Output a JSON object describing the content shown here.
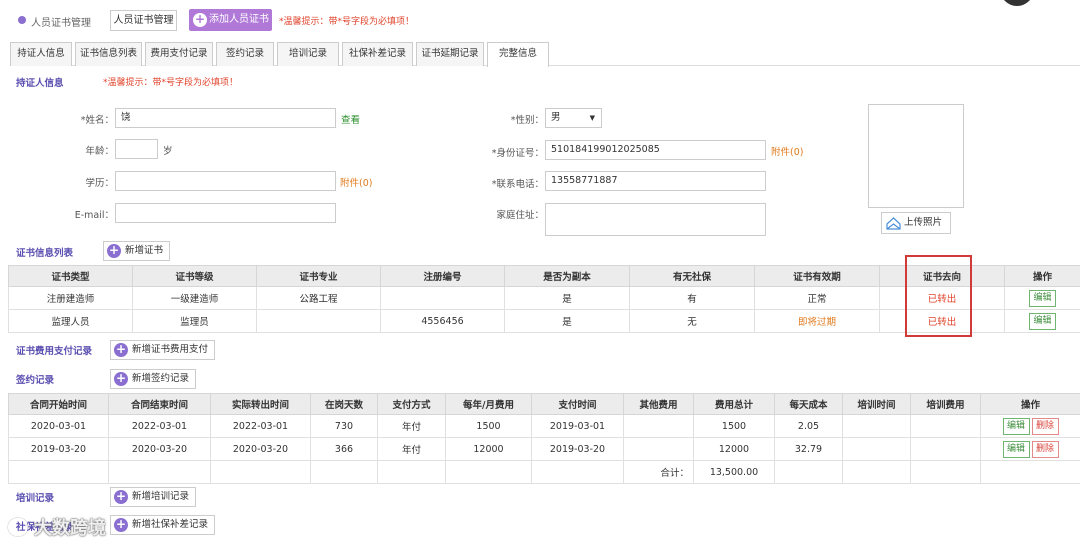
{
  "topbar": {
    "breadcrumb": "人员证书管理",
    "tab_button": "人员证书管理",
    "add_button": "添加人员证书",
    "warning": "*温馨提示：带*号字段为必填项！"
  },
  "tabs": [
    "持证人信息",
    "证书信息列表",
    "费用支付记录",
    "签约记录",
    "培训记录",
    "社保补差记录",
    "证书延期记录",
    "完整信息"
  ],
  "holder": {
    "title": "持证人信息",
    "warning": "*温馨提示：带*号字段为必填项！",
    "name_label": "*姓名：",
    "name_value": "饶",
    "view_link": "查看",
    "gender_label": "*性别：",
    "gender_value": "男",
    "age_label": "年龄：",
    "age_unit": "岁",
    "id_label": "*身份证号：",
    "id_value": "510184199012025085",
    "id_attach": "附件(0)",
    "edu_label": "学历：",
    "edu_attach": "附件(0)",
    "phone_label": "*联系电话：",
    "phone_value": "13558771887",
    "email_label": "E-mail：",
    "address_label": "家庭住址：",
    "upload_button": "上传照片"
  },
  "cert_list": {
    "title": "证书信息列表",
    "add_button": "新增证书",
    "columns": [
      "证书类型",
      "证书等级",
      "证书专业",
      "注册编号",
      "是否为副本",
      "有无社保",
      "证书有效期",
      "证书去向",
      "操作"
    ],
    "rows": [
      [
        "注册建造师",
        "一级建造师",
        "公路工程",
        "",
        "是",
        "有",
        "正常",
        "已转出",
        "编辑"
      ],
      [
        "监理人员",
        "监理员",
        "",
        "4556456",
        "是",
        "无",
        "即将过期",
        "已转出",
        "编辑"
      ]
    ]
  },
  "fee": {
    "title": "证书费用支付记录",
    "add_button": "新增证书费用支付"
  },
  "contract": {
    "title": "签约记录",
    "add_button": "新增签约记录",
    "columns": [
      "合同开始时间",
      "合同结束时间",
      "实际转出时间",
      "在岗天数",
      "支付方式",
      "每年/月费用",
      "支付时间",
      "其他费用",
      "费用总计",
      "每天成本",
      "培训时间",
      "培训费用",
      "操作"
    ],
    "rows": [
      [
        "2020-03-01",
        "2022-03-01",
        "2022-03-01",
        "730",
        "年付",
        "1500",
        "2019-03-01",
        "",
        "1500",
        "2.05",
        "",
        ""
      ],
      [
        "2019-03-20",
        "2020-03-20",
        "2020-03-20",
        "366",
        "年付",
        "12000",
        "2019-03-20",
        "",
        "12000",
        "32.79",
        "",
        ""
      ]
    ],
    "total_label": "合计：",
    "total_value": "13,500.00",
    "edit_label": "编辑",
    "delete_label": "删除"
  },
  "training": {
    "title": "培训记录",
    "add_button": "新增培训记录"
  },
  "social": {
    "title": "社保补差记录",
    "add_button": "新增社保补差记录"
  },
  "watermark": "大数跨境"
}
